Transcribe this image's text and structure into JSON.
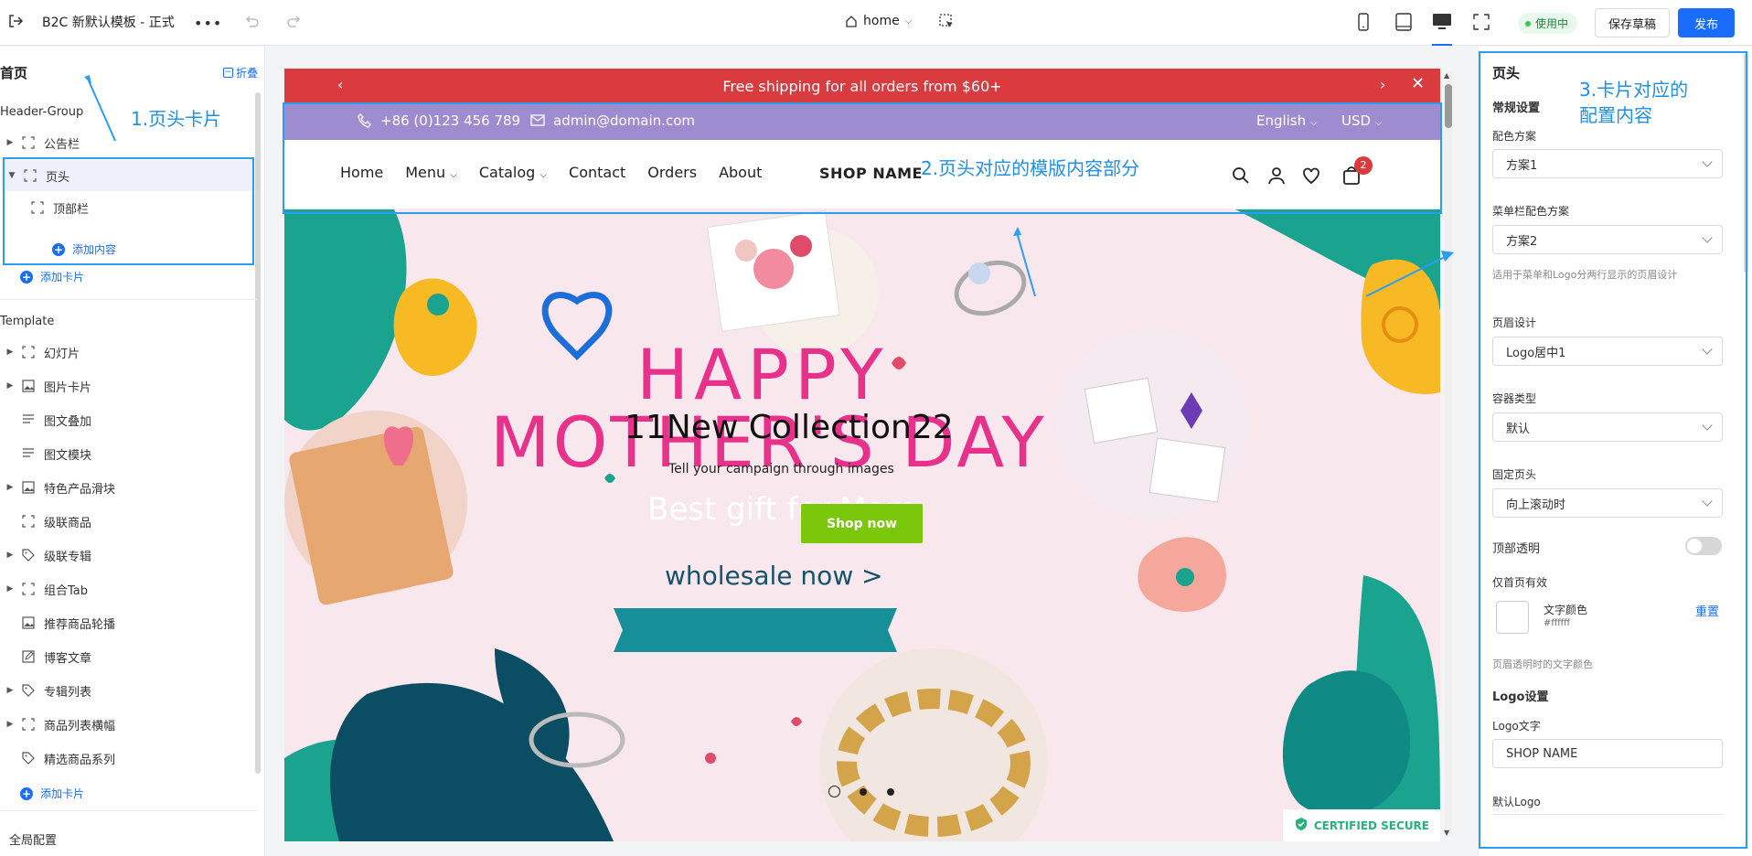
{
  "topbar": {
    "title": "B2C 新默认模板 - 正式",
    "page_select": "home",
    "status": "使用中",
    "save_draft": "保存草稿",
    "publish": "发布"
  },
  "sidebar": {
    "heading": "首页",
    "fold": "折叠",
    "group_label": "Header-Group",
    "header_items": [
      "公告栏",
      "页头"
    ],
    "sub_items": [
      "顶部栏"
    ],
    "add_content": "添加内容",
    "add_card": "添加卡片",
    "template_label": "Template",
    "template_items": [
      "幻灯片",
      "图片卡片",
      "图文叠加",
      "图文模块",
      "特色产品滑块",
      "级联商品",
      "级联专辑",
      "组合Tab",
      "推荐商品轮播",
      "博客文章",
      "专辑列表",
      "商品列表横幅",
      "精选商品系列"
    ],
    "add_card_2": "添加卡片",
    "global_config": "全局配置"
  },
  "annotations": {
    "label_1": "1.页头卡片",
    "label_2": "2.页头对应的模版内容部分",
    "label_3_line1": "3.卡片对应的",
    "label_3_line2": "配置内容"
  },
  "preview": {
    "announcement": "Free shipping for all orders from $60+",
    "phone": "+86 (0)123 456 789",
    "email": "admin@domain.com",
    "language": "English",
    "currency": "USD",
    "nav_items": [
      "Home",
      "Menu",
      "Catalog",
      "Contact",
      "Orders",
      "About"
    ],
    "shop_name": "SHOP NAME",
    "cart_count": "2",
    "hero_happy": "HAPPY",
    "hero_mothers": "MOTHER'S DAY",
    "hero_collection": "11New Collection22",
    "hero_tagline": "Tell your campaign through images",
    "hero_banner": "Best gift for Mom",
    "hero_button": "Shop now",
    "hero_wholesale": "wholesale now >",
    "secure_badge": "CERTIFIED SECURE"
  },
  "panel": {
    "title": "页头",
    "general": "常规设置",
    "color_scheme_label": "配色方案",
    "color_scheme_value": "方案1",
    "menu_scheme_label": "菜单栏配色方案",
    "menu_scheme_value": "方案2",
    "menu_scheme_hint": "适用于菜单和Logo分两行显示的页眉设计",
    "header_design_label": "页眉设计",
    "header_design_value": "Logo居中1",
    "container_label": "容器类型",
    "container_value": "默认",
    "sticky_label": "固定页头",
    "sticky_value": "向上滚动时",
    "transparent_label": "顶部透明",
    "homepage_only": "仅首页有效",
    "text_color_label": "文字颜色",
    "text_color_value": "#ffffff",
    "reset": "重置",
    "text_color_hint": "页眉透明时的文字颜色",
    "logo_settings": "Logo设置",
    "logo_text_label": "Logo文字",
    "logo_text_value": "SHOP NAME",
    "default_logo_label": "默认Logo"
  },
  "colors": {
    "accent": "#1a6dfb",
    "announcement_bg": "#d93b3f",
    "contact_bg": "#9e8cd0",
    "annotation_blue": "#2a9df4"
  }
}
